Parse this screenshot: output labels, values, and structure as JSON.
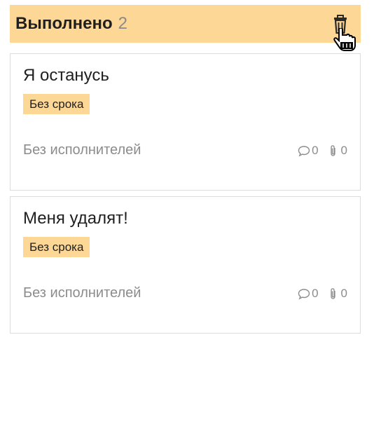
{
  "column": {
    "title": "Выполнено",
    "count": "2",
    "header_color": "#fdd796"
  },
  "cards": [
    {
      "title": "Я останусь",
      "deadline": "Без срока",
      "assignees": "Без исполнителей",
      "comments": "0",
      "attachments": "0"
    },
    {
      "title": "Меня удалят!",
      "deadline": "Без срока",
      "assignees": "Без исполнителей",
      "comments": "0",
      "attachments": "0"
    }
  ],
  "icons": {
    "header_action": "trash-icon",
    "comments": "comment-icon",
    "attachments": "paperclip-icon",
    "cursor": "hand-pointer-cursor"
  }
}
